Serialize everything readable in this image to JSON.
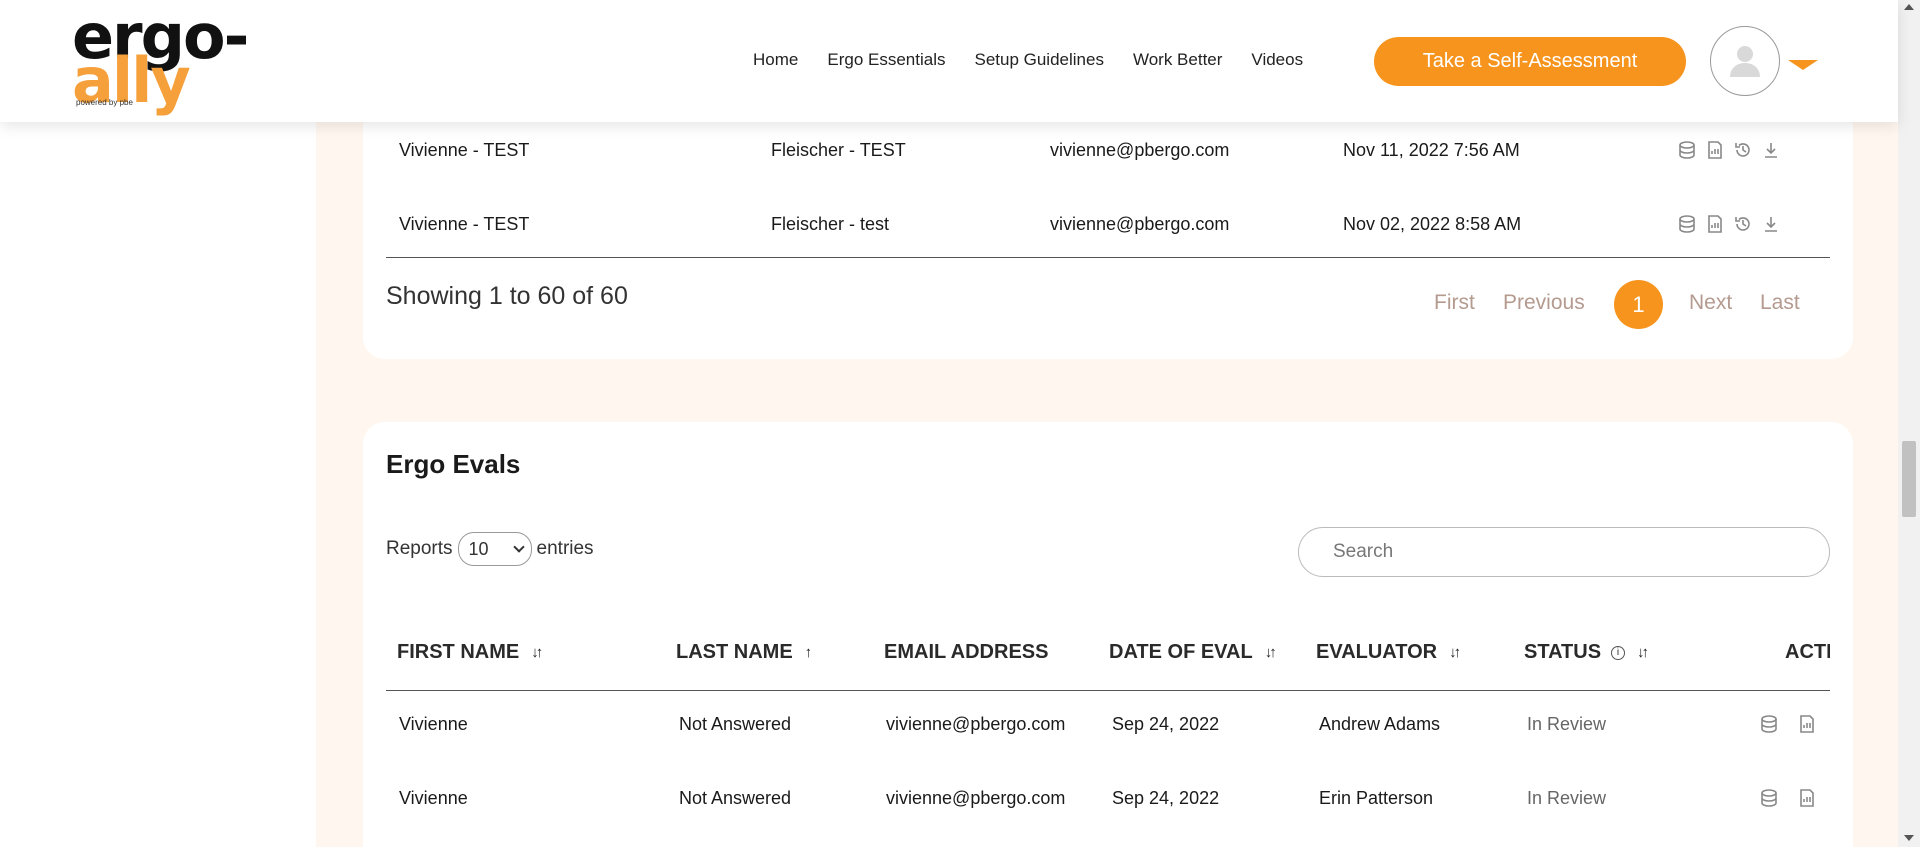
{
  "header": {
    "logo_top": "ergo-",
    "logo_bottom": "ally",
    "logo_tagline": "powered by pbe",
    "nav": [
      "Home",
      "Ergo Essentials",
      "Setup Guidelines",
      "Work Better",
      "Videos"
    ],
    "cta_label": "Take a Self-Assessment"
  },
  "table1": {
    "rows": [
      {
        "first": "Vivienne - TEST",
        "last": "Fleischer - TEST",
        "email": "vivienne@pbergo.com",
        "date": "Nov 11, 2022 7:56 AM"
      },
      {
        "first": "Vivienne - TEST",
        "last": "Fleischer - test",
        "email": "vivienne@pbergo.com",
        "date": "Nov 02, 2022 8:58 AM"
      }
    ],
    "showing": "Showing 1 to 60 of 60",
    "pager": {
      "first": "First",
      "previous": "Previous",
      "current": "1",
      "next": "Next",
      "last": "Last"
    }
  },
  "ergo_evals": {
    "title": "Ergo Evals",
    "reports_label": "Reports",
    "entries_select": "10",
    "entries_label": "entries",
    "search_placeholder": "Search",
    "columns": [
      "FIRST NAME",
      "LAST NAME",
      "EMAIL ADDRESS",
      "DATE OF EVAL",
      "EVALUATOR",
      "STATUS",
      "ACTI"
    ],
    "rows": [
      {
        "first": "Vivienne",
        "last": "Not Answered",
        "email": "vivienne@pbergo.com",
        "date": "Sep 24, 2022",
        "evaluator": "Andrew Adams",
        "status": "In Review"
      },
      {
        "first": "Vivienne",
        "last": "Not Answered",
        "email": "vivienne@pbergo.com",
        "date": "Sep 24, 2022",
        "evaluator": "Erin Patterson",
        "status": "In Review"
      }
    ]
  },
  "colors": {
    "accent": "#f7941d",
    "page_bg": "#fff7ef",
    "pager_text": "#b49a8f"
  }
}
